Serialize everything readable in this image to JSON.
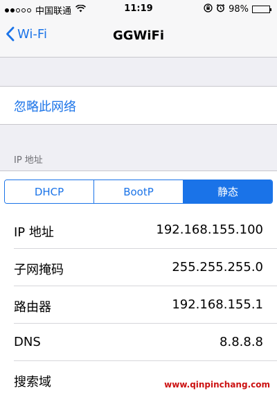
{
  "status_bar": {
    "carrier": "中国联通",
    "time": "11:19",
    "battery": "98%",
    "signal_filled": 2,
    "signal_total": 5
  },
  "nav": {
    "back_label": "Wi-Fi",
    "title": "GGWiFi"
  },
  "forget_network": {
    "label": "忽略此网络"
  },
  "ip_section": {
    "header": "IP 地址",
    "tabs": [
      {
        "label": "DHCP",
        "active": false
      },
      {
        "label": "BootP",
        "active": false
      },
      {
        "label": "静态",
        "active": true
      }
    ],
    "rows": [
      {
        "label": "IP 地址",
        "value": "192.168.155.100"
      },
      {
        "label": "子网掩码",
        "value": "255.255.255.0"
      },
      {
        "label": "路由器",
        "value": "192.168.155.1"
      },
      {
        "label": "DNS",
        "value": "8.8.8.8"
      },
      {
        "label": "搜索域",
        "value": ""
      }
    ]
  },
  "watermark": "www.qinpinchang.com",
  "colors": {
    "accent": "#1a73e8",
    "background": "#efeff4",
    "watermark": "#cc1111"
  }
}
